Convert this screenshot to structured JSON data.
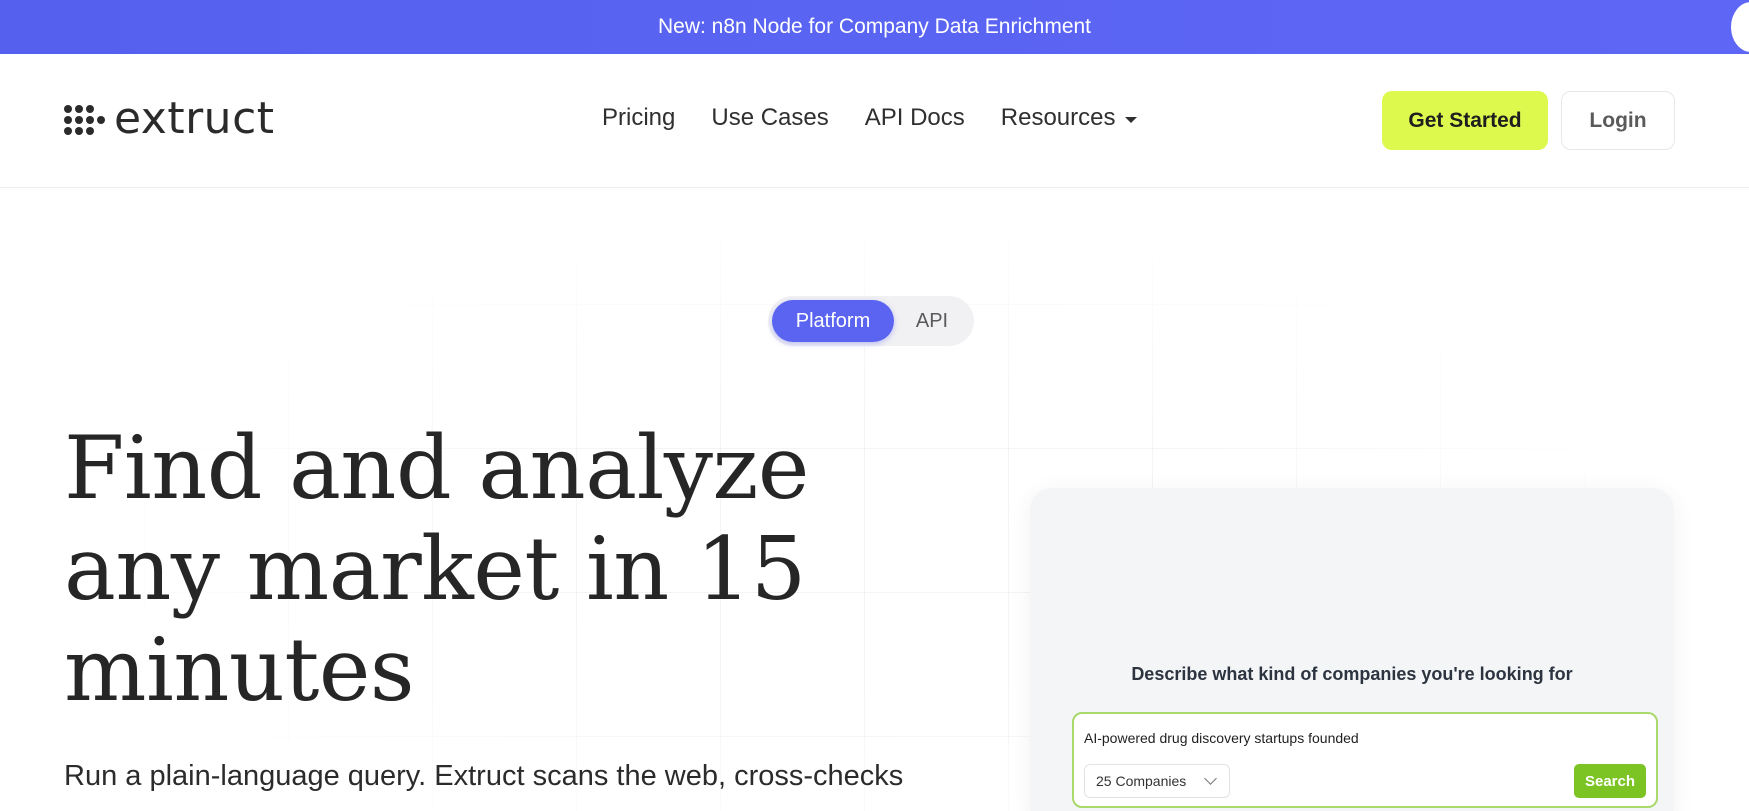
{
  "announcement": {
    "text": "New: n8n Node for Company Data Enrichment"
  },
  "header": {
    "logo_text": "extruct",
    "nav": [
      {
        "label": "Pricing"
      },
      {
        "label": "Use Cases"
      },
      {
        "label": "API Docs"
      },
      {
        "label": "Resources",
        "has_dropdown": true
      }
    ],
    "get_started_label": "Get Started",
    "login_label": "Login"
  },
  "toggle": {
    "options": [
      "Platform",
      "API"
    ],
    "active": "Platform"
  },
  "hero": {
    "headline_lines": [
      "Find and analyze",
      "any market in 15",
      "minutes"
    ],
    "subtext": "Run a plain-language query. Extruct scans the web, cross-checks"
  },
  "card": {
    "prompt": "Describe what kind of companies you're looking for",
    "query_value": "AI-powered drug discovery startups founded",
    "count_selected": "25 Companies",
    "search_label": "Search"
  },
  "colors": {
    "announcement_bg": "#5a64f2",
    "primary_cta": "#ddf94e",
    "toggle_active": "#5b64f0",
    "search_button": "#7cc424",
    "search_border": "#a9d86b"
  },
  "icons": {
    "logo": "dots-logo-icon",
    "resources_dropdown": "caret-down-icon",
    "count_dropdown": "chevron-down-icon"
  }
}
